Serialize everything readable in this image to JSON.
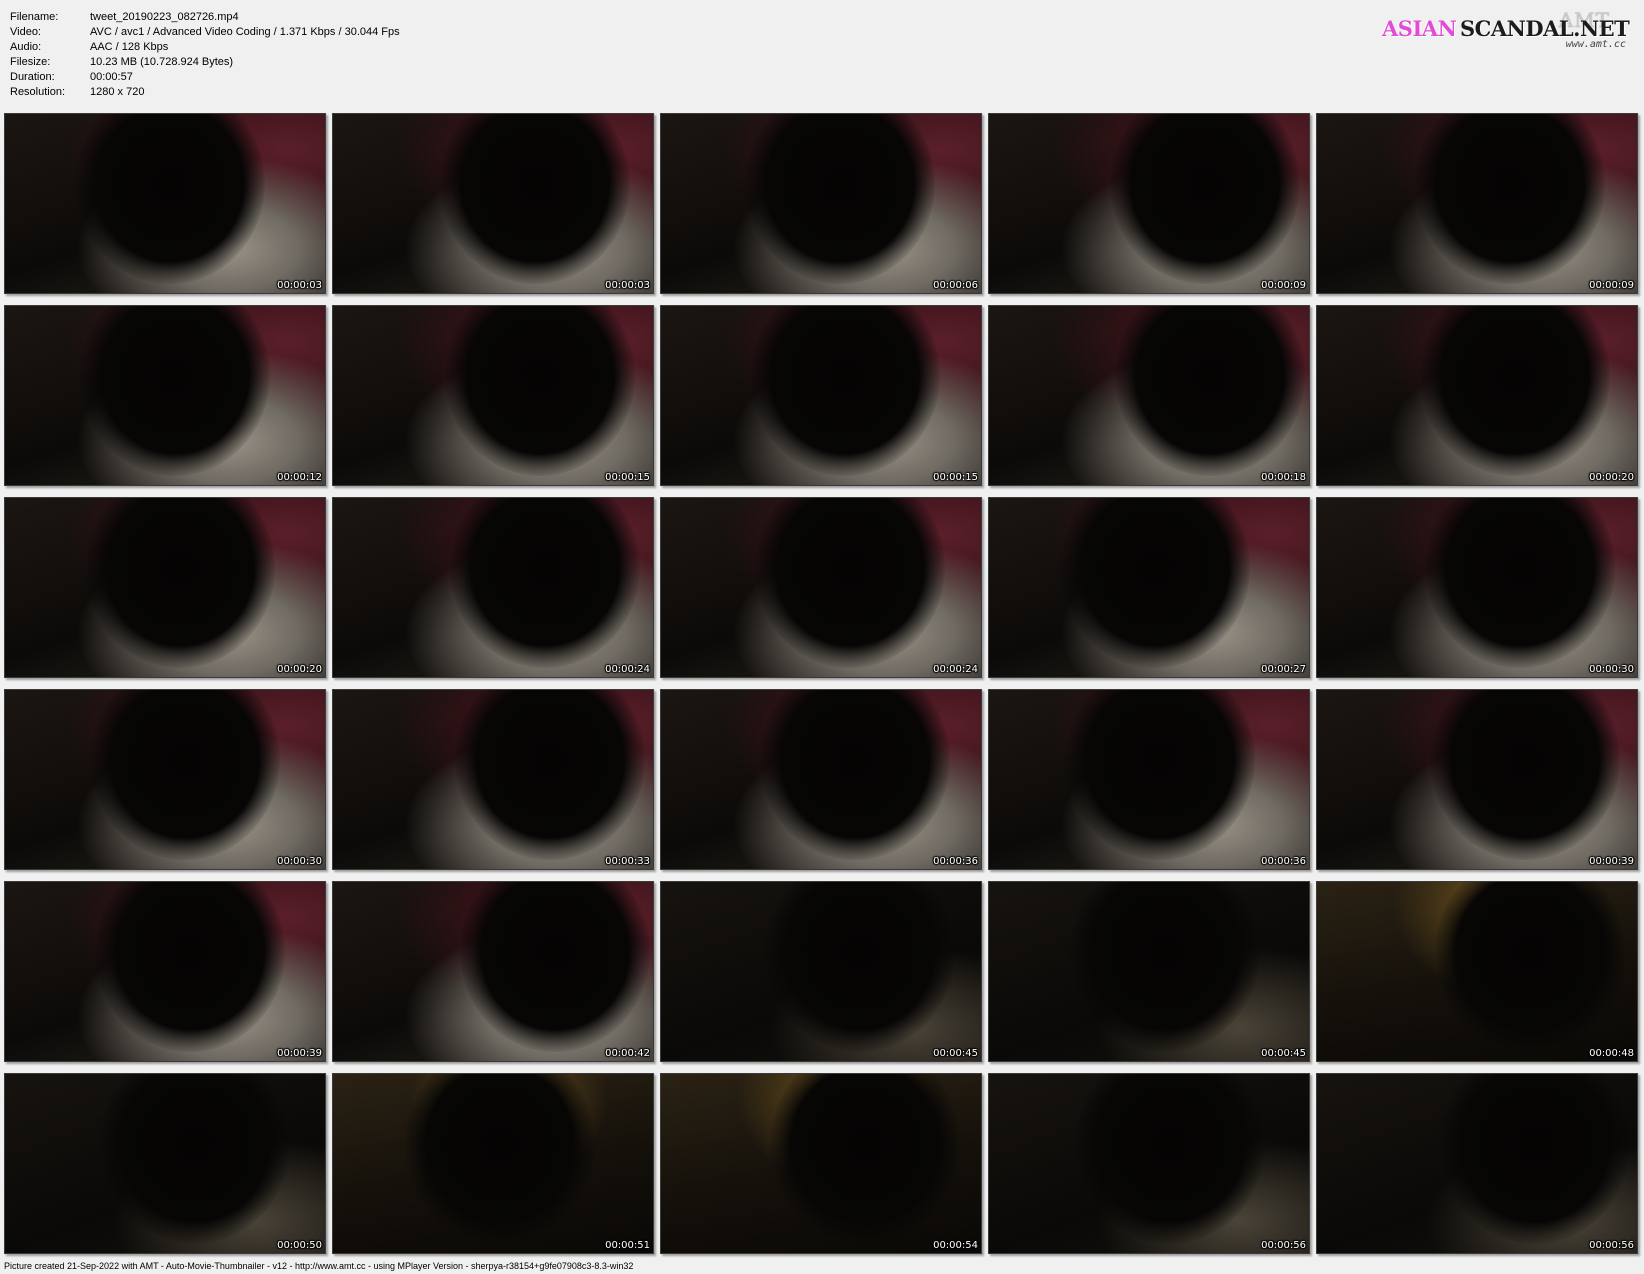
{
  "info": {
    "rows": [
      {
        "label": "Filename:",
        "value": "tweet_20190223_082726.mp4"
      },
      {
        "label": "Video:",
        "value": "AVC / avc1 / Advanced Video Coding / 1.371 Kbps / 30.044 Fps"
      },
      {
        "label": "Audio:",
        "value": "AAC / 128 Kbps"
      },
      {
        "label": "Filesize:",
        "value": "10.23 MB (10.728.924 Bytes)"
      },
      {
        "label": "Duration:",
        "value": "00:00:57"
      },
      {
        "label": "Resolution:",
        "value": "1280 x 720"
      }
    ]
  },
  "logo": {
    "word1": "ASIAN",
    "word2": "SCANDAL.NET",
    "mark": "AMT",
    "url": "www.amt.cc",
    "colors": {
      "asian": "#e24bd6",
      "scandal": "#1c1c1c"
    }
  },
  "thumbnails": [
    {
      "time": "00:00:03",
      "scene": "bed"
    },
    {
      "time": "00:00:03",
      "scene": "bed"
    },
    {
      "time": "00:00:06",
      "scene": "bed"
    },
    {
      "time": "00:00:09",
      "scene": "bed"
    },
    {
      "time": "00:00:09",
      "scene": "bed"
    },
    {
      "time": "00:00:12",
      "scene": "bed"
    },
    {
      "time": "00:00:15",
      "scene": "bed"
    },
    {
      "time": "00:00:15",
      "scene": "bed"
    },
    {
      "time": "00:00:18",
      "scene": "bed"
    },
    {
      "time": "00:00:20",
      "scene": "bed"
    },
    {
      "time": "00:00:20",
      "scene": "bed"
    },
    {
      "time": "00:00:24",
      "scene": "bed"
    },
    {
      "time": "00:00:24",
      "scene": "bed"
    },
    {
      "time": "00:00:27",
      "scene": "bed"
    },
    {
      "time": "00:00:30",
      "scene": "bed"
    },
    {
      "time": "00:00:30",
      "scene": "bed"
    },
    {
      "time": "00:00:33",
      "scene": "bed"
    },
    {
      "time": "00:00:36",
      "scene": "bed"
    },
    {
      "time": "00:00:36",
      "scene": "bed"
    },
    {
      "time": "00:00:39",
      "scene": "bed"
    },
    {
      "time": "00:00:39",
      "scene": "bed"
    },
    {
      "time": "00:00:42",
      "scene": "bed"
    },
    {
      "time": "00:00:45",
      "scene": "dark"
    },
    {
      "time": "00:00:45",
      "scene": "dark"
    },
    {
      "time": "00:00:48",
      "scene": "warm"
    },
    {
      "time": "00:00:50",
      "scene": "dark"
    },
    {
      "time": "00:00:51",
      "scene": "warm"
    },
    {
      "time": "00:00:54",
      "scene": "warm"
    },
    {
      "time": "00:00:56",
      "scene": "dark"
    },
    {
      "time": "00:00:56",
      "scene": "dark"
    }
  ],
  "footer": "Picture created 21-Sep-2022 with AMT - Auto-Movie-Thumbnailer - v12 - http://www.amt.cc - using MPlayer Version - sherpya-r38154+g9fe07908c3-8.3-win32"
}
